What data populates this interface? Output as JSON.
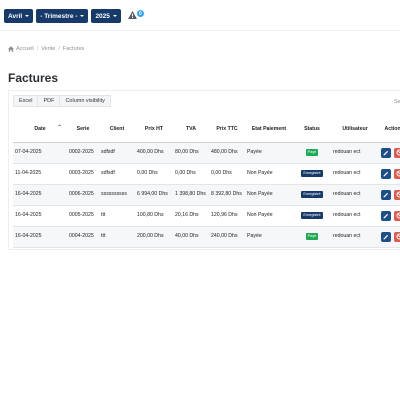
{
  "filters": {
    "month": "Avril",
    "quarter": "- Trimestre -",
    "year": "2025",
    "notification_count": "0"
  },
  "breadcrumb": {
    "home": "Accueil",
    "section": "Vente",
    "current": "Factures"
  },
  "page_title": "Factures",
  "toolbar": {
    "excel": "Excel",
    "pdf": "PDF",
    "column_visibility": "Column visibility",
    "search_label": "Se"
  },
  "table": {
    "headers": {
      "date": "Date",
      "serie": "Serie",
      "client": "Client",
      "prix_ht": "Prix HT",
      "tva": "TVA",
      "prix_ttc": "Prix TTC",
      "etat_paiement": "Etat Paiement",
      "status": "Status",
      "utilisateur": "Utilisateur",
      "actions": "Actions"
    },
    "rows": [
      {
        "date": "07-04-2025",
        "serie": "0002-2025",
        "client": "sdfsdf",
        "prix_ht": "400,00 Dhs",
        "tva": "80,00 Dhs",
        "prix_ttc": "480,00 Dhs",
        "etat": "Payée",
        "status": "Payé",
        "user": "redouan ect"
      },
      {
        "date": "11-04-2025",
        "serie": "0003-2025",
        "client": "sdfsdf",
        "prix_ht": "0,00 Dhs",
        "tva": "0,00 Dhs",
        "prix_ttc": "0,00 Dhs",
        "etat": "Non Payée",
        "status": "Enregistré",
        "user": "redouan ect"
      },
      {
        "date": "16-04-2025",
        "serie": "0006-2025",
        "client": "ssssssssss",
        "prix_ht": "6 994,00 Dhs",
        "tva": "1 398,80 Dhs",
        "prix_ttc": "8 392,80 Dhs",
        "etat": "Non Payée",
        "status": "Enregistré",
        "user": "redouan ect"
      },
      {
        "date": "16-04-2025",
        "serie": "0005-2025",
        "client": "ttt",
        "prix_ht": "100,80 Dhs",
        "tva": "20,16 Dhs",
        "prix_ttc": "120,96 Dhs",
        "etat": "Non Payée",
        "status": "Enregistré",
        "user": "redouan ect"
      },
      {
        "date": "16-04-2025",
        "serie": "0004-2025",
        "client": "ttt",
        "prix_ht": "200,00 Dhs",
        "tva": "40,00 Dhs",
        "prix_ttc": "240,00 Dhs",
        "etat": "Payée",
        "status": "Payé",
        "user": "redouan ect"
      }
    ]
  },
  "icons": {
    "alert": "warning-icon",
    "home": "home-icon",
    "sort": "sort-icon",
    "edit": "pencil-icon",
    "delete": "delete-icon"
  },
  "colors": {
    "navy": "#173a6b",
    "paid_green": "#1fa952",
    "delete_red": "#e05a4f",
    "badge_blue": "#2ea3f2"
  }
}
